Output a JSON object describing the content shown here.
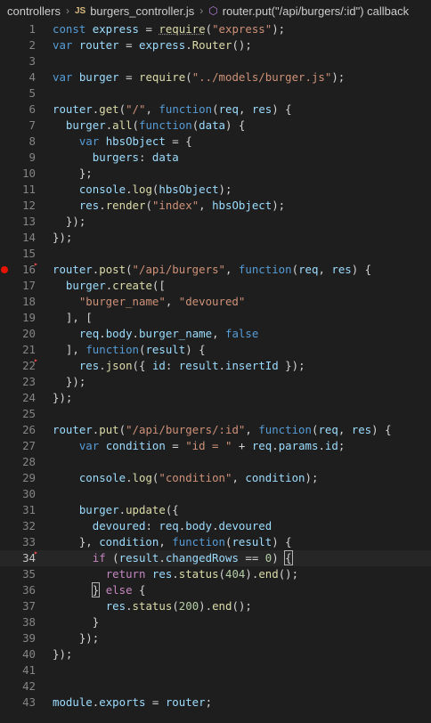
{
  "breadcrumb": {
    "folder": "controllers",
    "file_icon": "JS",
    "file": "burgers_controller.js",
    "symbol": "router.put(\"/api/burgers/:id\") callback"
  },
  "editor": {
    "current_line": 34,
    "breakpoint_line": 16,
    "lines": [
      {
        "n": "1",
        "t": [
          [
            "k",
            "const "
          ],
          [
            "v",
            "express"
          ],
          [
            "p",
            " = "
          ],
          [
            "f",
            "require"
          ],
          [
            "p",
            "("
          ],
          [
            "s",
            "\"express\""
          ],
          [
            "p",
            ");"
          ]
        ]
      },
      {
        "n": "2",
        "t": [
          [
            "k",
            "var "
          ],
          [
            "v",
            "router"
          ],
          [
            "p",
            " = "
          ],
          [
            "v",
            "express"
          ],
          [
            "p",
            "."
          ],
          [
            "f",
            "Router"
          ],
          [
            "p",
            "();"
          ]
        ]
      },
      {
        "n": "3",
        "t": []
      },
      {
        "n": "4",
        "t": [
          [
            "k",
            "var "
          ],
          [
            "v",
            "burger"
          ],
          [
            "p",
            " = "
          ],
          [
            "f",
            "require"
          ],
          [
            "p",
            "("
          ],
          [
            "s",
            "\"../models/burger.js\""
          ],
          [
            "p",
            ");"
          ]
        ]
      },
      {
        "n": "5",
        "t": []
      },
      {
        "n": "6",
        "t": [
          [
            "v",
            "router"
          ],
          [
            "p",
            "."
          ],
          [
            "f",
            "get"
          ],
          [
            "p",
            "("
          ],
          [
            "s",
            "\"/\""
          ],
          [
            "p",
            ", "
          ],
          [
            "k",
            "function"
          ],
          [
            "p",
            "("
          ],
          [
            "v",
            "req"
          ],
          [
            "p",
            ", "
          ],
          [
            "v",
            "res"
          ],
          [
            "p",
            ") {"
          ]
        ]
      },
      {
        "n": "7",
        "t": [
          [
            "p",
            "  "
          ],
          [
            "v",
            "burger"
          ],
          [
            "p",
            "."
          ],
          [
            "f",
            "all"
          ],
          [
            "p",
            "("
          ],
          [
            "k",
            "function"
          ],
          [
            "p",
            "("
          ],
          [
            "v",
            "data"
          ],
          [
            "p",
            ") {"
          ]
        ]
      },
      {
        "n": "8",
        "t": [
          [
            "p",
            "    "
          ],
          [
            "k",
            "var "
          ],
          [
            "v",
            "hbsObject"
          ],
          [
            "p",
            " = {"
          ]
        ]
      },
      {
        "n": "9",
        "t": [
          [
            "p",
            "      "
          ],
          [
            "v",
            "burgers"
          ],
          [
            "p",
            ": "
          ],
          [
            "v",
            "data"
          ]
        ]
      },
      {
        "n": "10",
        "t": [
          [
            "p",
            "    };"
          ]
        ]
      },
      {
        "n": "11",
        "t": [
          [
            "p",
            "    "
          ],
          [
            "v",
            "console"
          ],
          [
            "p",
            "."
          ],
          [
            "f",
            "log"
          ],
          [
            "p",
            "("
          ],
          [
            "v",
            "hbsObject"
          ],
          [
            "p",
            ");"
          ]
        ]
      },
      {
        "n": "12",
        "t": [
          [
            "p",
            "    "
          ],
          [
            "v",
            "res"
          ],
          [
            "p",
            "."
          ],
          [
            "f",
            "render"
          ],
          [
            "p",
            "("
          ],
          [
            "s",
            "\"index\""
          ],
          [
            "p",
            ", "
          ],
          [
            "v",
            "hbsObject"
          ],
          [
            "p",
            ");"
          ]
        ]
      },
      {
        "n": "13",
        "t": [
          [
            "p",
            "  });"
          ]
        ]
      },
      {
        "n": "14",
        "t": [
          [
            "p",
            "});"
          ]
        ]
      },
      {
        "n": "15",
        "t": []
      },
      {
        "n": "16",
        "t": [
          [
            "v",
            "router"
          ],
          [
            "p",
            "."
          ],
          [
            "f",
            "post"
          ],
          [
            "p",
            "("
          ],
          [
            "s",
            "\"/api/burgers\""
          ],
          [
            "p",
            ", "
          ],
          [
            "k",
            "function"
          ],
          [
            "p",
            "("
          ],
          [
            "v",
            "req"
          ],
          [
            "p",
            ", "
          ],
          [
            "v",
            "res"
          ],
          [
            "p",
            ") {"
          ]
        ]
      },
      {
        "n": "17",
        "t": [
          [
            "p",
            "  "
          ],
          [
            "v",
            "burger"
          ],
          [
            "p",
            "."
          ],
          [
            "f",
            "create"
          ],
          [
            "p",
            "(["
          ]
        ]
      },
      {
        "n": "18",
        "t": [
          [
            "p",
            "    "
          ],
          [
            "s",
            "\"burger_name\""
          ],
          [
            "p",
            ", "
          ],
          [
            "s",
            "\"devoured\""
          ]
        ]
      },
      {
        "n": "19",
        "t": [
          [
            "p",
            "  ], ["
          ]
        ]
      },
      {
        "n": "20",
        "t": [
          [
            "p",
            "    "
          ],
          [
            "v",
            "req"
          ],
          [
            "p",
            "."
          ],
          [
            "v",
            "body"
          ],
          [
            "p",
            "."
          ],
          [
            "v",
            "burger_name"
          ],
          [
            "p",
            ", "
          ],
          [
            "k",
            "false"
          ]
        ]
      },
      {
        "n": "21",
        "t": [
          [
            "p",
            "  ], "
          ],
          [
            "k",
            "function"
          ],
          [
            "p",
            "("
          ],
          [
            "v",
            "result"
          ],
          [
            "p",
            ") {"
          ]
        ]
      },
      {
        "n": "22",
        "t": [
          [
            "p",
            "    "
          ],
          [
            "v",
            "res"
          ],
          [
            "p",
            "."
          ],
          [
            "f",
            "json"
          ],
          [
            "p",
            "({ "
          ],
          [
            "v",
            "id"
          ],
          [
            "p",
            ": "
          ],
          [
            "v",
            "result"
          ],
          [
            "p",
            "."
          ],
          [
            "v",
            "insertId"
          ],
          [
            "p",
            " });"
          ]
        ]
      },
      {
        "n": "23",
        "t": [
          [
            "p",
            "  });"
          ]
        ]
      },
      {
        "n": "24",
        "t": [
          [
            "p",
            "});"
          ]
        ]
      },
      {
        "n": "25",
        "t": []
      },
      {
        "n": "26",
        "t": [
          [
            "v",
            "router"
          ],
          [
            "p",
            "."
          ],
          [
            "f",
            "put"
          ],
          [
            "p",
            "("
          ],
          [
            "s",
            "\"/api/burgers/:id\""
          ],
          [
            "p",
            ", "
          ],
          [
            "k",
            "function"
          ],
          [
            "p",
            "("
          ],
          [
            "v",
            "req"
          ],
          [
            "p",
            ", "
          ],
          [
            "v",
            "res"
          ],
          [
            "p",
            ") {"
          ]
        ]
      },
      {
        "n": "27",
        "t": [
          [
            "p",
            "    "
          ],
          [
            "k",
            "var "
          ],
          [
            "v",
            "condition"
          ],
          [
            "p",
            " = "
          ],
          [
            "s",
            "\"id = \""
          ],
          [
            "p",
            " + "
          ],
          [
            "v",
            "req"
          ],
          [
            "p",
            "."
          ],
          [
            "v",
            "params"
          ],
          [
            "p",
            "."
          ],
          [
            "v",
            "id"
          ],
          [
            "p",
            ";"
          ]
        ]
      },
      {
        "n": "28",
        "t": []
      },
      {
        "n": "29",
        "t": [
          [
            "p",
            "    "
          ],
          [
            "v",
            "console"
          ],
          [
            "p",
            "."
          ],
          [
            "f",
            "log"
          ],
          [
            "p",
            "("
          ],
          [
            "s",
            "\"condition\""
          ],
          [
            "p",
            ", "
          ],
          [
            "v",
            "condition"
          ],
          [
            "p",
            ");"
          ]
        ]
      },
      {
        "n": "30",
        "t": []
      },
      {
        "n": "31",
        "t": [
          [
            "p",
            "    "
          ],
          [
            "v",
            "burger"
          ],
          [
            "p",
            "."
          ],
          [
            "f",
            "update"
          ],
          [
            "p",
            "({"
          ]
        ]
      },
      {
        "n": "32",
        "t": [
          [
            "p",
            "      "
          ],
          [
            "v",
            "devoured"
          ],
          [
            "p",
            ": "
          ],
          [
            "v",
            "req"
          ],
          [
            "p",
            "."
          ],
          [
            "v",
            "body"
          ],
          [
            "p",
            "."
          ],
          [
            "v",
            "devoured"
          ]
        ]
      },
      {
        "n": "33",
        "t": [
          [
            "p",
            "    }, "
          ],
          [
            "v",
            "condition"
          ],
          [
            "p",
            ", "
          ],
          [
            "k",
            "function"
          ],
          [
            "p",
            "("
          ],
          [
            "v",
            "result"
          ],
          [
            "p",
            ") {"
          ]
        ]
      },
      {
        "n": "34",
        "t": [
          [
            "p",
            "      "
          ],
          [
            "c",
            "if"
          ],
          [
            "p",
            " ("
          ],
          [
            "v",
            "result"
          ],
          [
            "p",
            "."
          ],
          [
            "v",
            "changedRows"
          ],
          [
            "p",
            " == "
          ],
          [
            "n",
            "0"
          ],
          [
            "p",
            ") "
          ],
          [
            "p",
            "{"
          ]
        ]
      },
      {
        "n": "35",
        "t": [
          [
            "p",
            "        "
          ],
          [
            "c",
            "return "
          ],
          [
            "v",
            "res"
          ],
          [
            "p",
            "."
          ],
          [
            "f",
            "status"
          ],
          [
            "p",
            "("
          ],
          [
            "n",
            "404"
          ],
          [
            "p",
            ")."
          ],
          [
            "f",
            "end"
          ],
          [
            "p",
            "();"
          ]
        ]
      },
      {
        "n": "36",
        "t": [
          [
            "p",
            "      "
          ],
          [
            "p",
            "}"
          ],
          [
            "p",
            " "
          ],
          [
            "c",
            "else"
          ],
          [
            "p",
            " {"
          ]
        ]
      },
      {
        "n": "37",
        "t": [
          [
            "p",
            "        "
          ],
          [
            "v",
            "res"
          ],
          [
            "p",
            "."
          ],
          [
            "f",
            "status"
          ],
          [
            "p",
            "("
          ],
          [
            "n",
            "200"
          ],
          [
            "p",
            ")."
          ],
          [
            "f",
            "end"
          ],
          [
            "p",
            "();"
          ]
        ]
      },
      {
        "n": "38",
        "t": [
          [
            "p",
            "      }"
          ]
        ]
      },
      {
        "n": "39",
        "t": [
          [
            "p",
            "    });"
          ]
        ]
      },
      {
        "n": "40",
        "t": [
          [
            "p",
            "});"
          ]
        ]
      },
      {
        "n": "41",
        "t": []
      },
      {
        "n": "42",
        "t": []
      },
      {
        "n": "43",
        "t": [
          [
            "v",
            "module"
          ],
          [
            "p",
            "."
          ],
          [
            "v",
            "exports"
          ],
          [
            "p",
            " = "
          ],
          [
            "v",
            "router"
          ],
          [
            "p",
            ";"
          ]
        ]
      }
    ]
  }
}
